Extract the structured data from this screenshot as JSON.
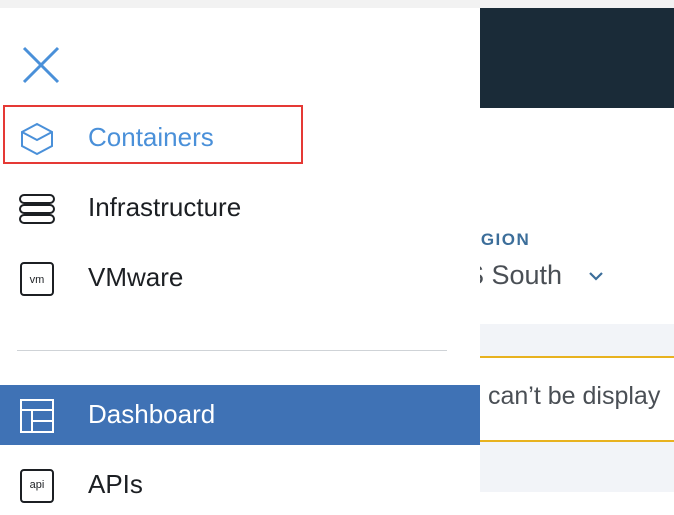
{
  "drawer": {
    "close_label": "Close",
    "items": [
      {
        "label": "Containers",
        "icon": "containers-icon",
        "selected": true
      },
      {
        "label": "Infrastructure",
        "icon": "infrastructure-icon"
      },
      {
        "label": "VMware",
        "icon": "vmware-icon",
        "icon_text": "vm"
      },
      {
        "label": "Dashboard",
        "icon": "dashboard-icon",
        "active": true
      },
      {
        "label": "APIs",
        "icon": "apis-icon",
        "icon_text": "api"
      }
    ]
  },
  "background": {
    "region_label": "EGION",
    "region_value": "S South",
    "notice_text": "can’t be display"
  },
  "colors": {
    "accent": "#4a90d9",
    "active_bg": "#3f72b5",
    "header_bg": "#1a2b38",
    "highlight_border": "#e53935",
    "notice_border": "#e8b21f"
  }
}
